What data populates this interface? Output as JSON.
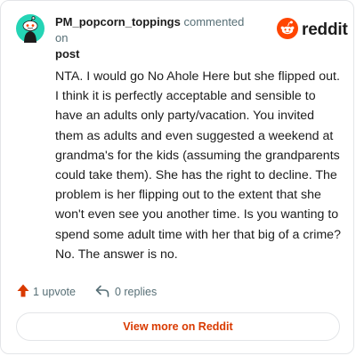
{
  "header": {
    "username": "PM_popcorn_toppings",
    "action_text": "commented on",
    "post_link": "post",
    "brand": "reddit",
    "avatar_icon": "snoo-avatar-icon",
    "brand_icon": "reddit-logo-icon"
  },
  "comment": {
    "text": "NTA. I would go No Ahole Here but she flipped out. I think it is perfectly acceptable and sensible to have an adults only party/vacation. You invited them as adults and even suggested a weekend at grandma's for the kids (assuming the grandparents could take them). She has the right to decline. The problem is her flipping out to the extent that she won't even see you another time. Is you wanting to spend some adult time with her that big of a crime? No. The answer is no."
  },
  "actions": {
    "upvote_label": "1 upvote",
    "reply_label": "0 replies",
    "upvote_icon": "upvote-arrow-icon",
    "reply_icon": "reply-arrow-icon"
  },
  "footer": {
    "view_more_label": "View more on Reddit"
  },
  "colors": {
    "accent": "#d93a00",
    "reddit_orange": "#ff4500",
    "avatar_teal": "#24d4b5",
    "text_primary": "#1c1c1c",
    "text_secondary": "#576f76",
    "border": "#e3e5e8"
  }
}
